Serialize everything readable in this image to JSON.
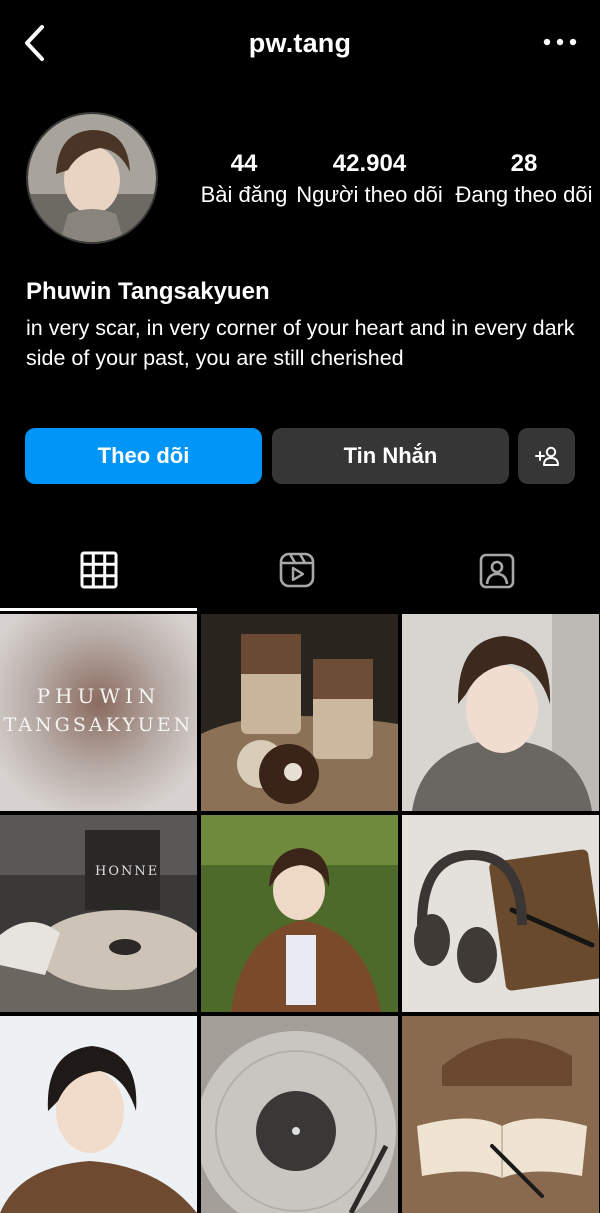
{
  "header": {
    "username": "pw.tang",
    "back_icon": "chevron-left-icon",
    "more_icon": "more-horizontal-icon"
  },
  "profile": {
    "stats": {
      "posts": {
        "value": "44",
        "label": "Bài đăng"
      },
      "followers": {
        "value": "42.904",
        "label": "Người theo dõi"
      },
      "following": {
        "value": "28",
        "label": "Đang theo dõi"
      }
    },
    "name": "Phuwin Tangsakyuen",
    "bio": "in very scar, in very corner of your heart and in every dark side of your past, you are still cherished"
  },
  "actions": {
    "follow_label": "Theo dõi",
    "message_label": "Tin Nhắn",
    "suggest_icon": "add-person-icon"
  },
  "tabs": [
    {
      "name": "posts",
      "icon": "grid-icon",
      "active": true
    },
    {
      "name": "reels",
      "icon": "reels-icon",
      "active": false
    },
    {
      "name": "tagged",
      "icon": "tagged-user-icon",
      "active": false
    }
  ],
  "grid": {
    "post1_text_line1": "PHUWIN",
    "post1_text_line2": "TANGSAKYUEN",
    "post4_album_text": "HONNE"
  },
  "colors": {
    "background": "#000000",
    "accent": "#0095f6",
    "secondary_button": "#363636"
  }
}
